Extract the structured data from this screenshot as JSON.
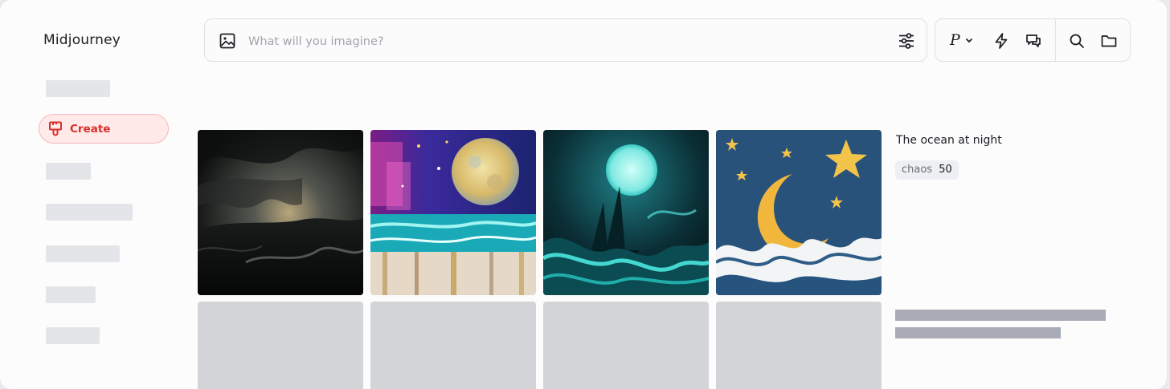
{
  "app": {
    "title": "Midjourney"
  },
  "sidebar": {
    "active_item": {
      "label": "Create",
      "icon": "paintbrush-icon",
      "color": "#d9302c"
    }
  },
  "search": {
    "placeholder": "What will you imagine?",
    "value": ""
  },
  "toolbar": {
    "personalize_label": "P"
  },
  "result": {
    "prompt": "The ocean at night",
    "parameter": {
      "name": "chaos",
      "value": "50"
    },
    "images": [
      {
        "name": "stormy-ocean-image",
        "subject": "dark stormy sea under cloudy sky"
      },
      {
        "name": "moon-over-sea-painting-image",
        "subject": "colorful painted moon over turquoise sea"
      },
      {
        "name": "ghost-ship-moon-image",
        "subject": "ship in glowing cyan waves under full moon"
      },
      {
        "name": "crescent-moon-waves-image",
        "subject": "yellow crescent moon and stars above waves"
      }
    ]
  },
  "colors": {
    "accent": "#d9302c",
    "accent_bg": "#ffe9e9",
    "skeleton": "#e4e5e9",
    "placeholder_tile": "#d3d4d8"
  }
}
